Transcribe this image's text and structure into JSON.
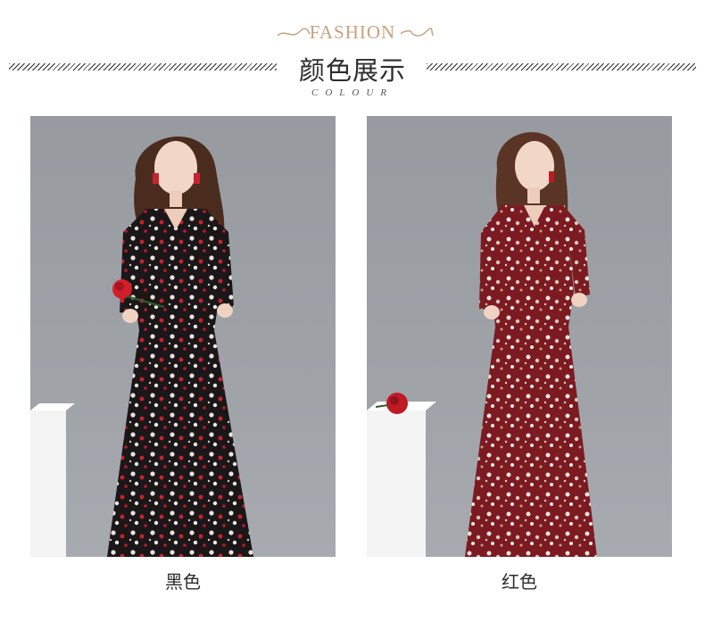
{
  "header": {
    "brand_text": "FASHION",
    "title_cn": "颜色展示",
    "title_en": "COLOUR"
  },
  "colors": {
    "gold_accent": "#c9a27c",
    "text_dark": "#2d2d2d",
    "photo_bg": "#9ea2a7",
    "dress_black": "#1b1718",
    "dress_red": "#7c1a22"
  },
  "products": [
    {
      "color_label": "黑色"
    },
    {
      "color_label": "红色"
    }
  ]
}
